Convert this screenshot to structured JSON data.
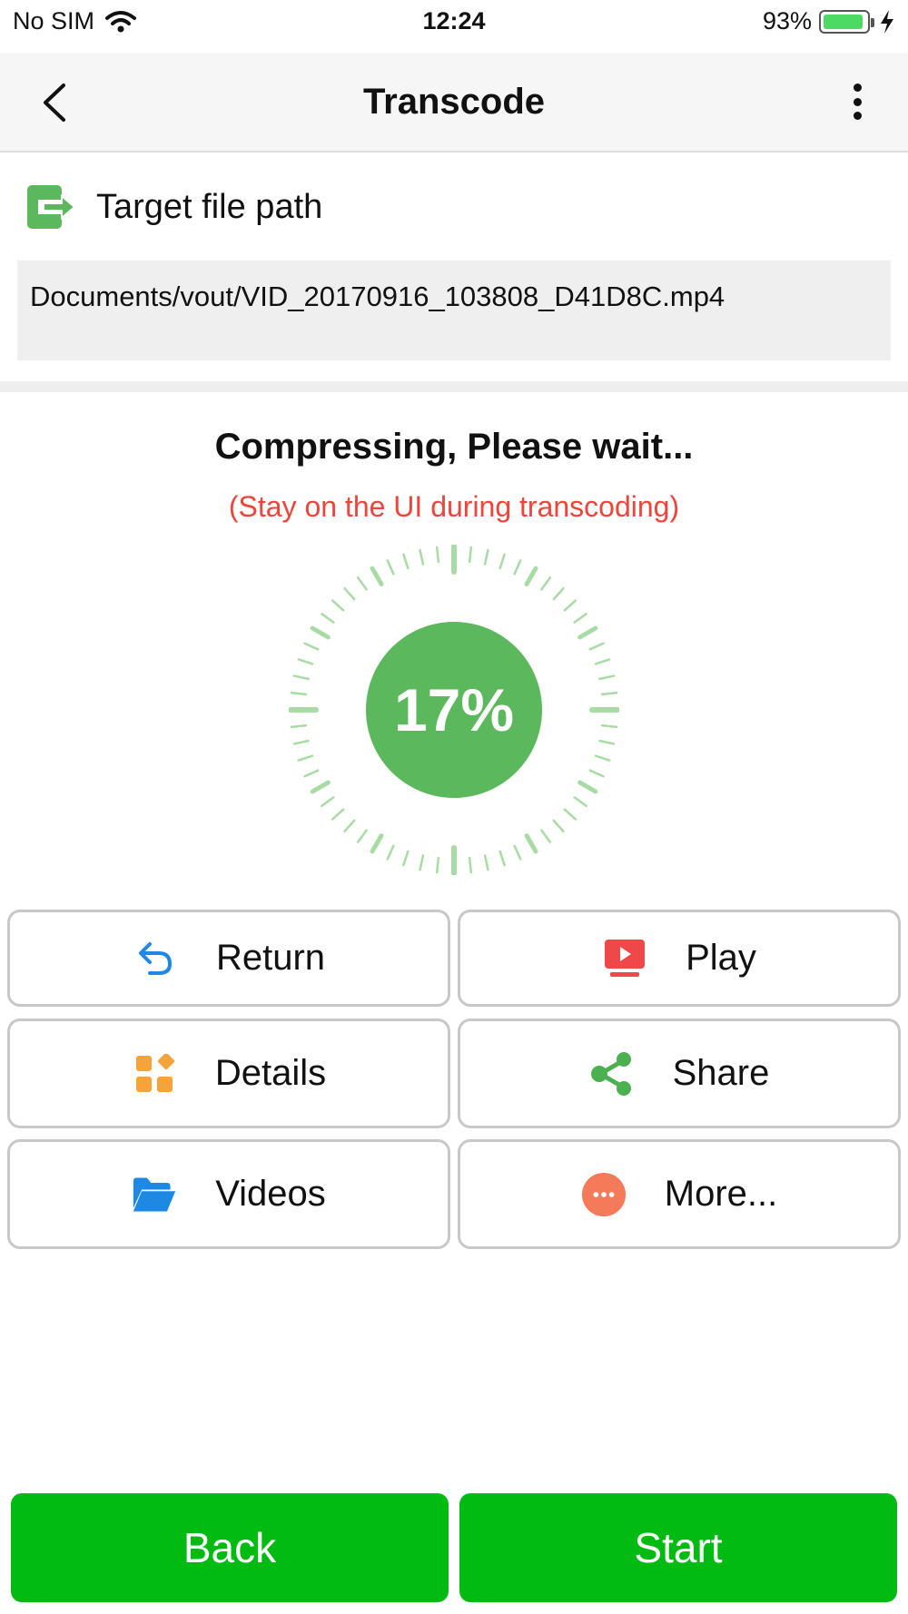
{
  "status_bar": {
    "carrier": "No SIM",
    "time": "12:24",
    "battery_percent": "93%",
    "battery_level": 0.93
  },
  "nav": {
    "title": "Transcode"
  },
  "target": {
    "label": "Target file path",
    "path": "Documents/vout/VID_20170916_103808_D41D8C.mp4"
  },
  "progress": {
    "title": "Compressing, Please wait...",
    "note": "(Stay on the UI during transcoding)",
    "percent_text": "17%",
    "percent": 17
  },
  "actions": {
    "return_label": "Return",
    "play_label": "Play",
    "details_label": "Details",
    "share_label": "Share",
    "videos_label": "Videos",
    "more_label": "More..."
  },
  "bottom": {
    "back_label": "Back",
    "start_label": "Start"
  },
  "colors": {
    "primary_green": "#02bb12",
    "progress_green": "#5cb85c",
    "warning_red": "#f0443a",
    "icon_blue": "#1e88e5",
    "icon_red": "#f04848",
    "icon_orange": "#f4a43a",
    "icon_share_green": "#4caf50",
    "icon_more_orange": "#f47a5a"
  },
  "icons": {
    "target": "export-icon",
    "return": "undo-icon",
    "play": "play-screen-icon",
    "details": "grid-icon",
    "share": "share-icon",
    "videos": "folder-icon",
    "more": "more-dots-icon"
  }
}
